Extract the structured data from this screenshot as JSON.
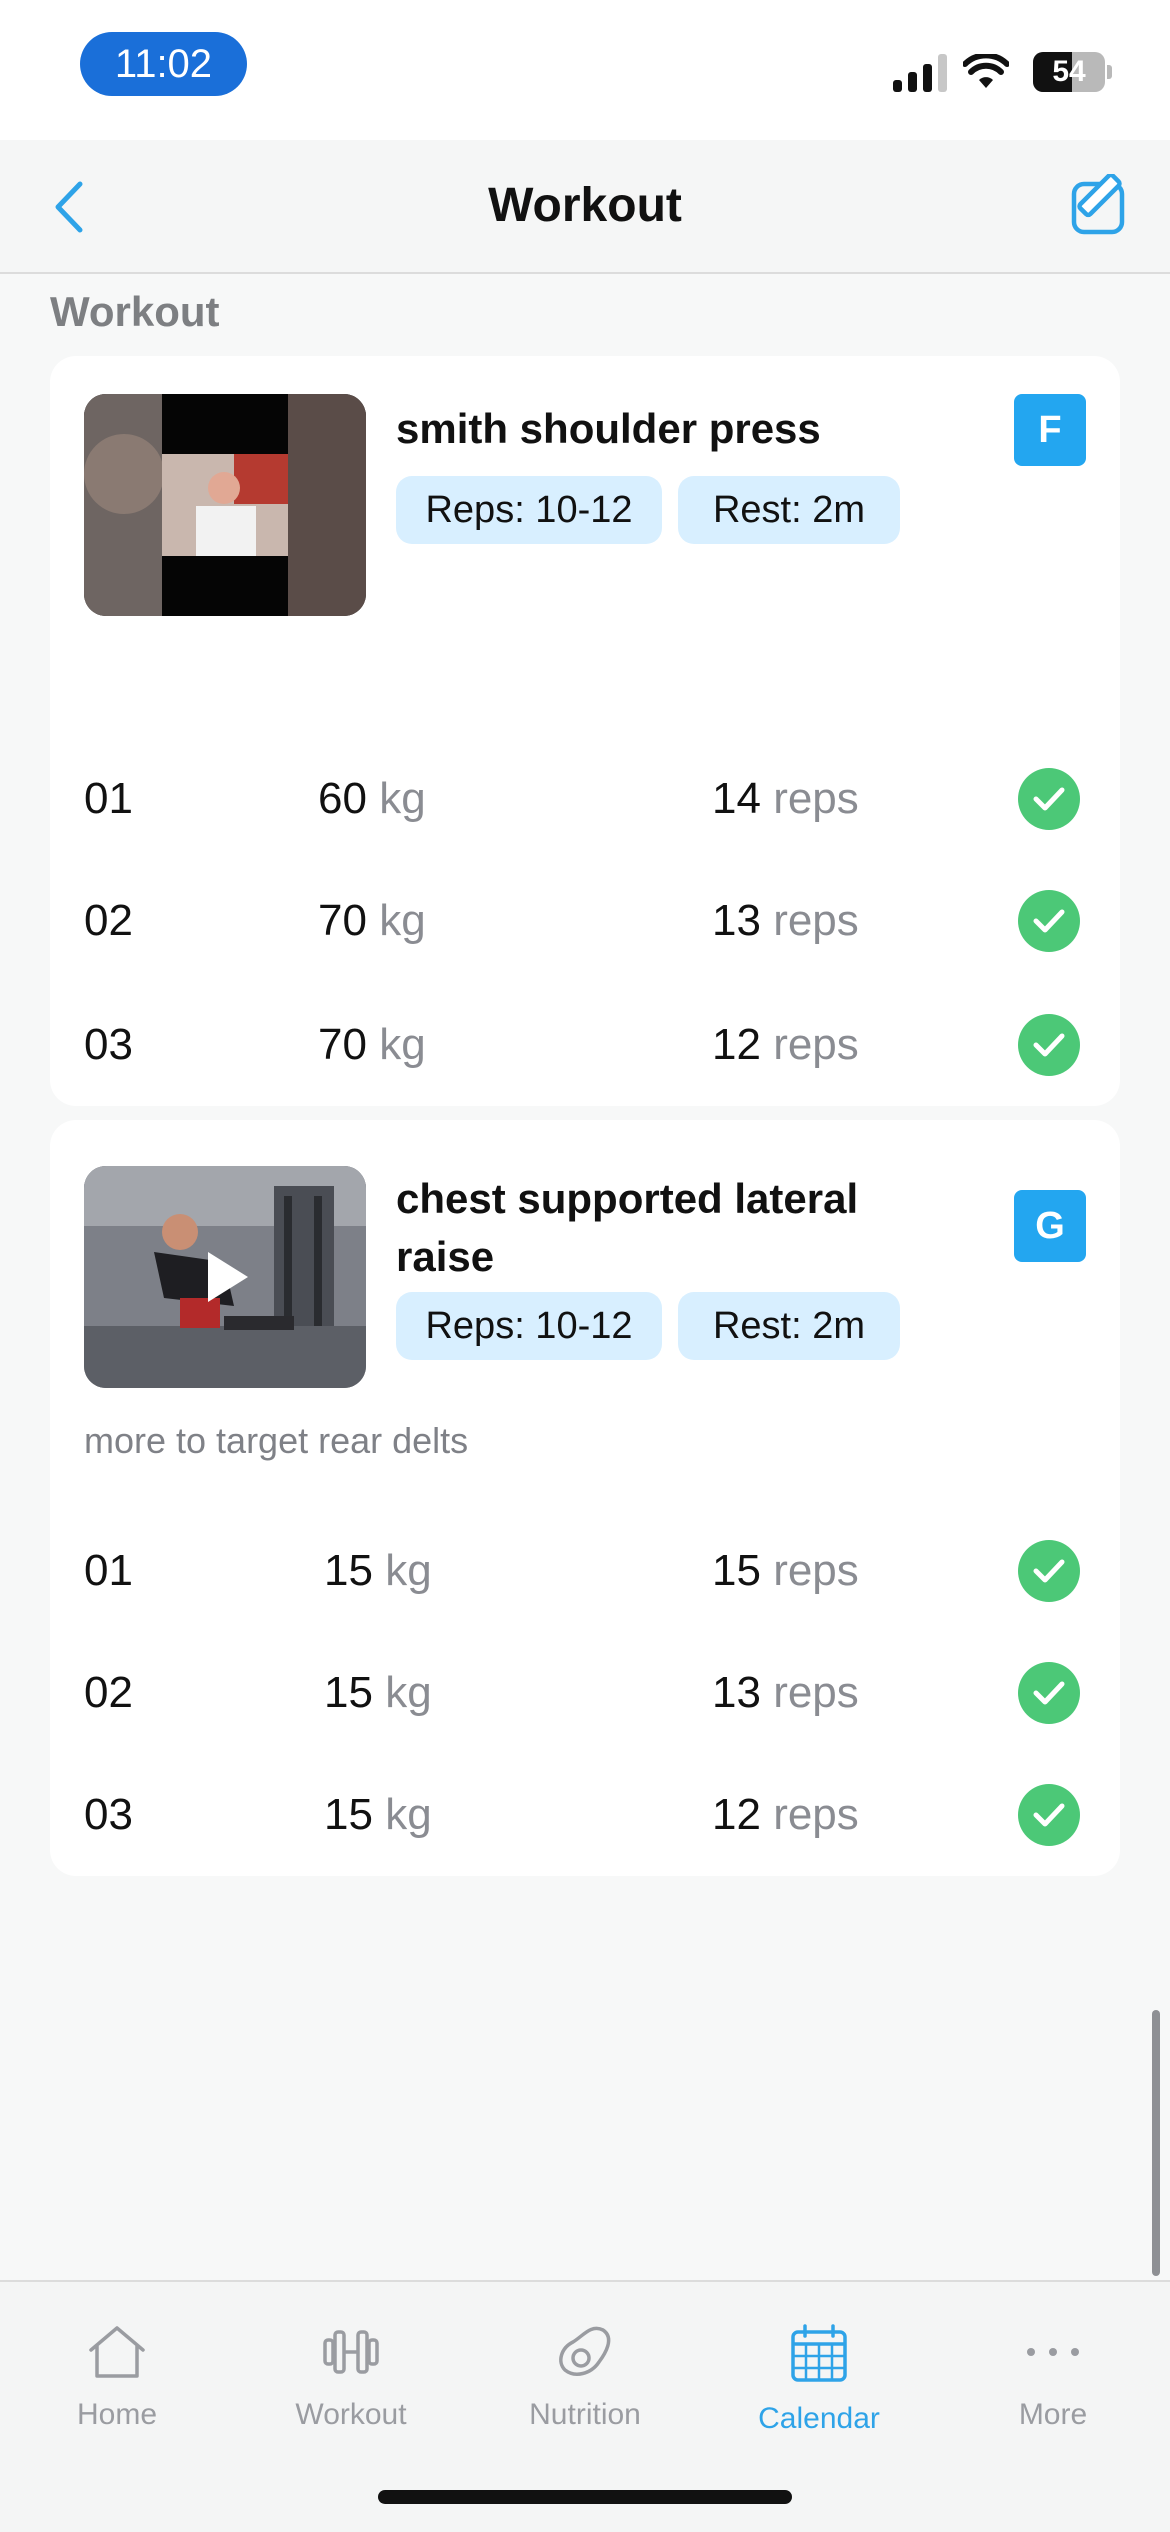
{
  "status_bar": {
    "time": "11:02",
    "battery": "54"
  },
  "nav": {
    "title": "Workout"
  },
  "section": {
    "label": "Workout"
  },
  "exercises": [
    {
      "name": "smith shoulder press",
      "reps_tag": "Reps: 10-12",
      "rest_tag": "Rest: 2m",
      "badge": "F",
      "note": "",
      "sets": [
        {
          "num": "01",
          "kg": "60",
          "kg_unit": "kg",
          "reps": "14",
          "reps_unit": "reps",
          "completed": true
        },
        {
          "num": "02",
          "kg": "70",
          "kg_unit": "kg",
          "reps": "13",
          "reps_unit": "reps",
          "completed": true
        },
        {
          "num": "03",
          "kg": "70",
          "kg_unit": "kg",
          "reps": "12",
          "reps_unit": "reps",
          "completed": true
        }
      ]
    },
    {
      "name": "chest supported lateral raise",
      "reps_tag": "Reps: 10-12",
      "rest_tag": "Rest: 2m",
      "badge": "G",
      "note": "more to target rear delts",
      "sets": [
        {
          "num": "01",
          "kg": "15",
          "kg_unit": "kg",
          "reps": "15",
          "reps_unit": "reps",
          "completed": true
        },
        {
          "num": "02",
          "kg": "15",
          "kg_unit": "kg",
          "reps": "13",
          "reps_unit": "reps",
          "completed": true
        },
        {
          "num": "03",
          "kg": "15",
          "kg_unit": "kg",
          "reps": "12",
          "reps_unit": "reps",
          "completed": true
        }
      ]
    }
  ],
  "tabs": [
    {
      "label": "Home",
      "icon": "home-icon",
      "active": false
    },
    {
      "label": "Workout",
      "icon": "dumbbell-icon",
      "active": false
    },
    {
      "label": "Nutrition",
      "icon": "avocado-icon",
      "active": false
    },
    {
      "label": "Calendar",
      "icon": "calendar-icon",
      "active": true
    },
    {
      "label": "More",
      "icon": "more-dots-icon",
      "active": false
    }
  ],
  "colors": {
    "accent": "#2ea3e8",
    "badge": "#23a6f0",
    "check": "#4cc877",
    "tag_bg": "#d8efff",
    "time_pill": "#1a6fd9"
  }
}
